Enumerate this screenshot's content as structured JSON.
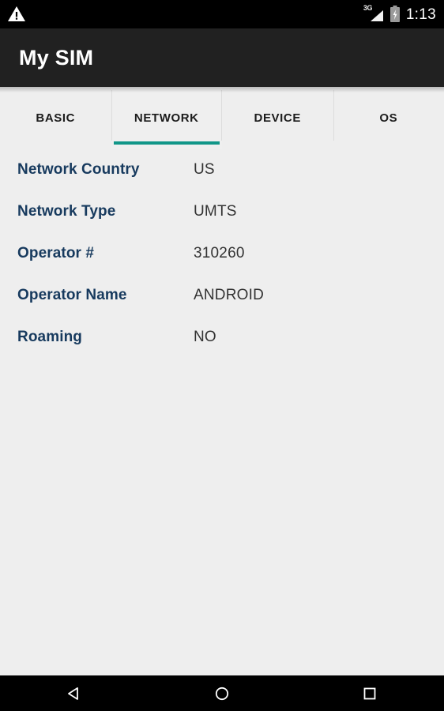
{
  "status_bar": {
    "warning_icon": "warning-triangle-icon",
    "signal_icon": "signal-bars-icon",
    "signal_label": "3G",
    "battery_icon": "battery-charging-icon",
    "time": "1:13"
  },
  "app_bar": {
    "title": "My SIM"
  },
  "tabs": {
    "accent_color": "#119688",
    "active_index": 1,
    "items": [
      {
        "label": "BASIC"
      },
      {
        "label": "NETWORK"
      },
      {
        "label": "DEVICE"
      },
      {
        "label": "OS"
      }
    ]
  },
  "content": {
    "rows": [
      {
        "label": "Network Country",
        "value": "US"
      },
      {
        "label": "Network Type",
        "value": "UMTS"
      },
      {
        "label": "Operator #",
        "value": "310260"
      },
      {
        "label": "Operator Name",
        "value": "ANDROID"
      },
      {
        "label": "Roaming",
        "value": "NO"
      }
    ]
  },
  "nav_bar": {
    "back": "back-triangle-icon",
    "home": "home-circle-icon",
    "recents": "recents-square-icon"
  }
}
